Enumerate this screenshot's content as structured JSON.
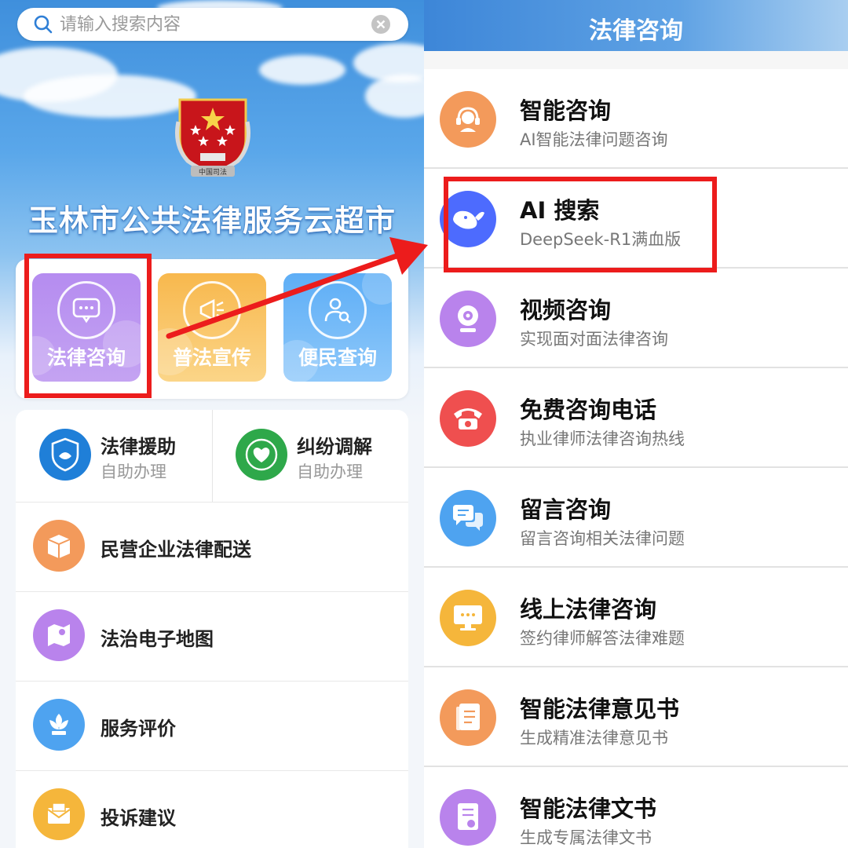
{
  "left": {
    "search": {
      "placeholder": "请输入搜索内容"
    },
    "site_title": "玉林市公共法律服务云超市",
    "emblem_text": "中国司法",
    "tiles": [
      {
        "label": "法律咨询",
        "icon": "chat-bubble-icon"
      },
      {
        "label": "普法宣传",
        "icon": "megaphone-icon"
      },
      {
        "label": "便民查询",
        "icon": "user-search-icon"
      }
    ],
    "halves": [
      {
        "title": "法律援助",
        "sub": "自助办理",
        "icon": "legal-aid-shield-icon"
      },
      {
        "title": "纠纷调解",
        "sub": "自助办理",
        "icon": "handshake-heart-icon"
      }
    ],
    "services": [
      {
        "label": "民营企业法律配送",
        "icon": "package-box-icon",
        "color": "#f39a5b"
      },
      {
        "label": "法治电子地图",
        "icon": "map-pin-icon",
        "color": "#b983ec"
      },
      {
        "label": "服务评价",
        "icon": "flower-icon",
        "color": "#4ea3f0"
      },
      {
        "label": "投诉建议",
        "icon": "mail-envelope-icon",
        "color": "#f5b63b"
      }
    ]
  },
  "right": {
    "header_title": "法律咨询",
    "items": [
      {
        "title": "智能咨询",
        "sub": "AI智能法律问题咨询",
        "icon": "headset-agent-icon",
        "color": "#f39a5b"
      },
      {
        "title": "AI 搜索",
        "sub": "DeepSeek-R1满血版",
        "icon": "deepseek-whale-icon",
        "color": "#4d6bfe"
      },
      {
        "title": "视频咨询",
        "sub": "实现面对面法律咨询",
        "icon": "webcam-icon",
        "color": "#b983ec"
      },
      {
        "title": "免费咨询电话",
        "sub": "执业律师法律咨询热线",
        "icon": "telephone-icon",
        "color": "#ef4f4f"
      },
      {
        "title": "留言咨询",
        "sub": "留言咨询相关法律问题",
        "icon": "message-bubbles-icon",
        "color": "#4ea3f0"
      },
      {
        "title": "线上法律咨询",
        "sub": "签约律师解答法律难题",
        "icon": "monitor-icon",
        "color": "#f5b63b"
      },
      {
        "title": "智能法律意见书",
        "sub": "生成精准法律意见书",
        "icon": "document-icon",
        "color": "#f39a5b"
      },
      {
        "title": "智能法律文书",
        "sub": "生成专属法律文书",
        "icon": "legal-document-icon",
        "color": "#b983ec"
      }
    ]
  },
  "annotation_color": "#ec1c1c"
}
